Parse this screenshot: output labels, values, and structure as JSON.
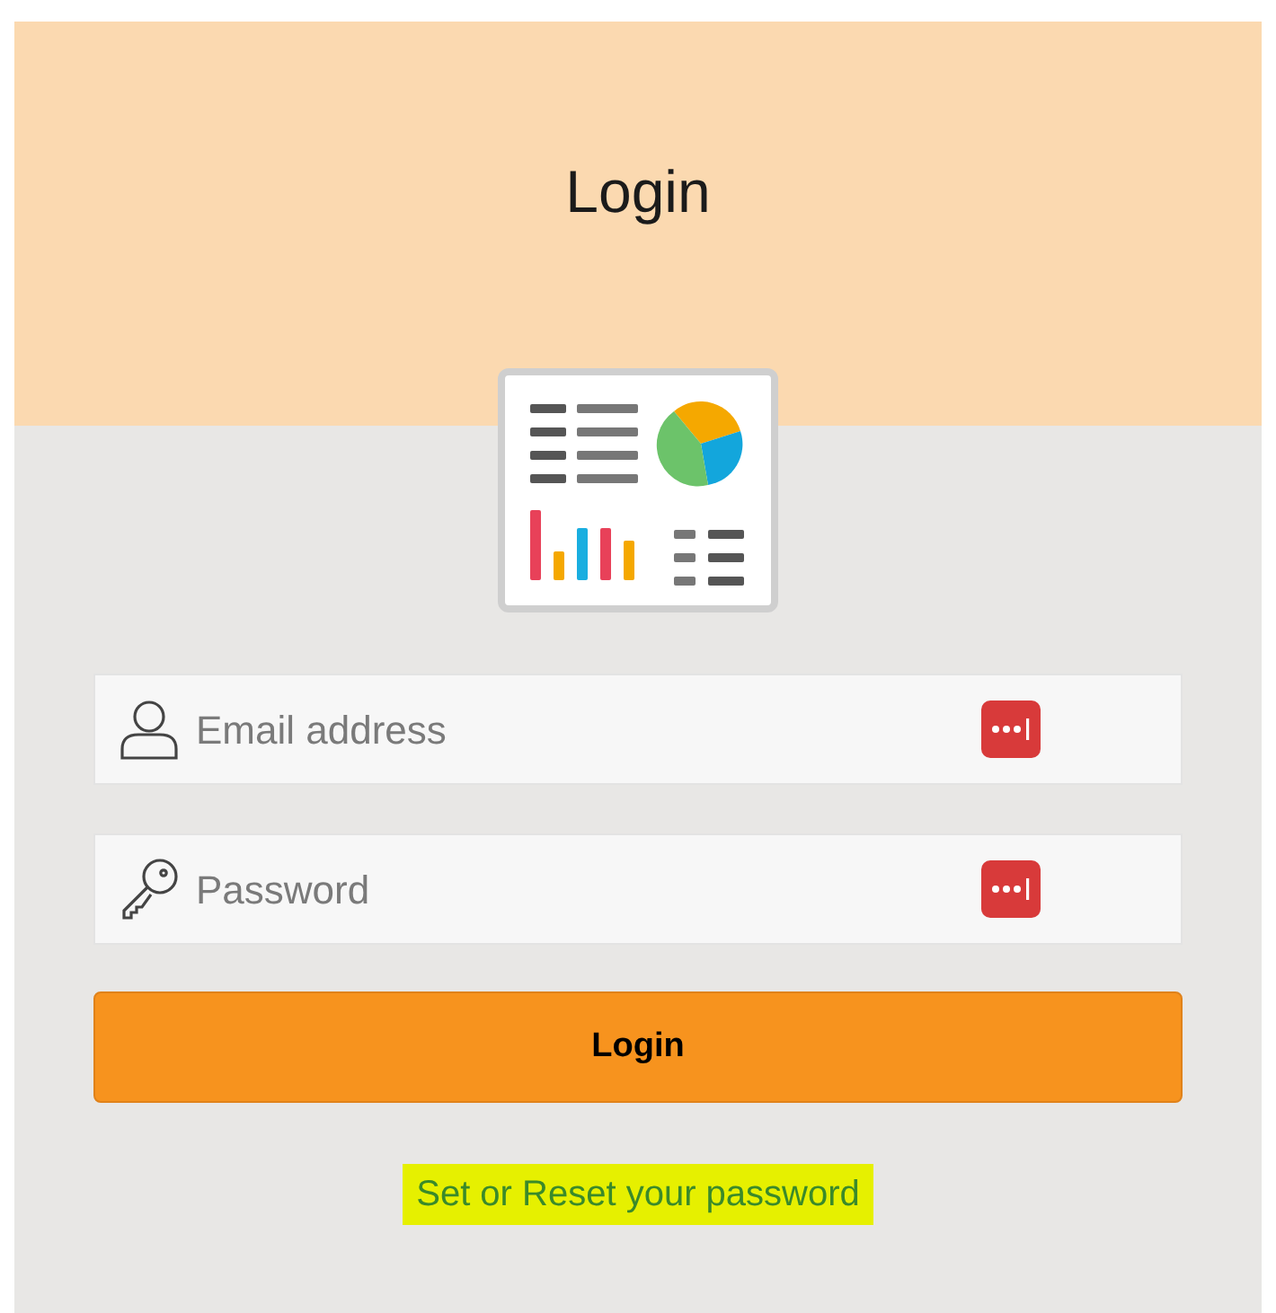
{
  "header": {
    "title": "Login"
  },
  "fields": [
    {
      "kind": "email",
      "placeholder": "Email address"
    },
    {
      "kind": "password",
      "placeholder": "Password"
    }
  ],
  "login_button": {
    "label": "Login"
  },
  "reset_link": {
    "label": "Set or Reset your password",
    "highlighted": true
  }
}
